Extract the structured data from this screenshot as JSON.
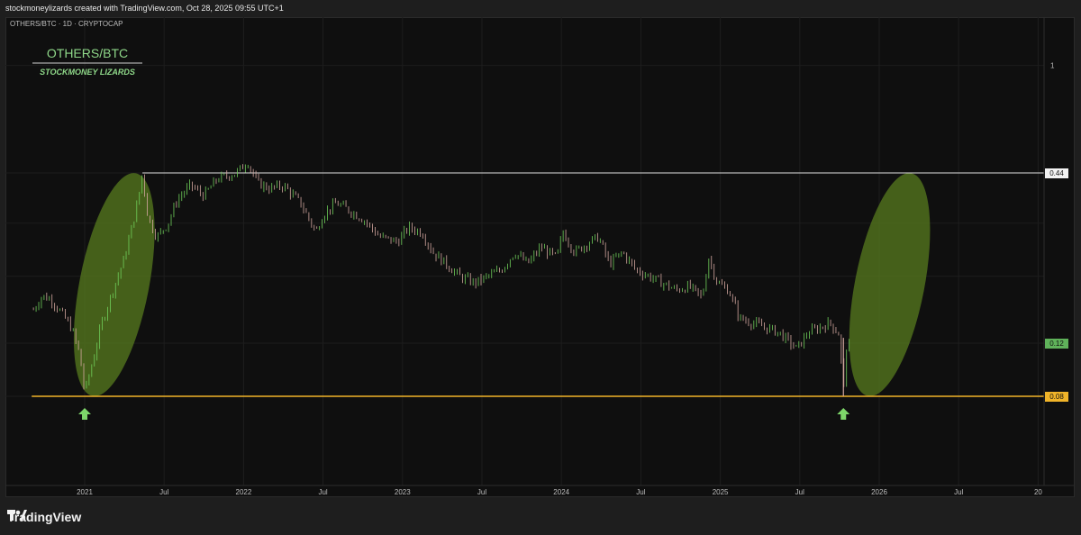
{
  "header": {
    "attribution": "stockmoneylizards created with TradingView.com, Oct 28, 2025 09:55 UTC+1"
  },
  "symbol_line": "OTHERS/BTC · 1D · CRYPTOCAP",
  "watermark": {
    "title": "OTHERS/BTC",
    "subtitle": "STOCKMONEY LIZARDS"
  },
  "footer": {
    "brand": "TradingView",
    "icon": "tradingview-logo-icon"
  },
  "colors": {
    "background": "#0f0f0f",
    "up": "#6fcf5a",
    "down": "#d4a7a0",
    "support": "#f0b429",
    "resistance": "#e0e0e0",
    "ellipse": "#55771e",
    "arrow": "#7ed66a"
  },
  "chart_data": {
    "type": "candlestick",
    "title": "OTHERS/BTC",
    "x_axis": {
      "type": "date",
      "range": [
        "2020-09-01",
        "2026-12-31"
      ],
      "tick_labels": [
        "2021",
        "Jul",
        "2022",
        "Jul",
        "2023",
        "Jul",
        "2024",
        "Jul",
        "2025",
        "Jul",
        "2026",
        "Jul",
        "20"
      ]
    },
    "y_axis": {
      "scale": "log",
      "range": [
        0.05,
        1.5
      ],
      "tick_labels": [
        "1"
      ],
      "right_side": true
    },
    "series": [
      {
        "type": "line-approximation",
        "points": [
          [
            "2020-09-05",
            0.155
          ],
          [
            "2020-09-25",
            0.172
          ],
          [
            "2020-10-15",
            0.168
          ],
          [
            "2020-11-10",
            0.15
          ],
          [
            "2020-12-01",
            0.135
          ],
          [
            "2020-12-20",
            0.11
          ],
          [
            "2021-01-01",
            0.082
          ],
          [
            "2021-01-20",
            0.105
          ],
          [
            "2021-02-10",
            0.14
          ],
          [
            "2021-03-05",
            0.18
          ],
          [
            "2021-04-01",
            0.23
          ],
          [
            "2021-05-01",
            0.35
          ],
          [
            "2021-05-12",
            0.44
          ],
          [
            "2021-05-25",
            0.31
          ],
          [
            "2021-06-15",
            0.27
          ],
          [
            "2021-07-10",
            0.3
          ],
          [
            "2021-08-01",
            0.36
          ],
          [
            "2021-09-01",
            0.4
          ],
          [
            "2021-10-01",
            0.37
          ],
          [
            "2021-11-01",
            0.42
          ],
          [
            "2021-12-15",
            0.44
          ],
          [
            "2022-01-10",
            0.48
          ],
          [
            "2022-02-01",
            0.41
          ],
          [
            "2022-03-01",
            0.39
          ],
          [
            "2022-04-01",
            0.4
          ],
          [
            "2022-05-10",
            0.35
          ],
          [
            "2022-06-15",
            0.28
          ],
          [
            "2022-07-01",
            0.32
          ],
          [
            "2022-08-01",
            0.35
          ],
          [
            "2022-09-01",
            0.33
          ],
          [
            "2022-10-01",
            0.31
          ],
          [
            "2022-11-10",
            0.27
          ],
          [
            "2022-12-20",
            0.26
          ],
          [
            "2023-01-15",
            0.29
          ],
          [
            "2023-02-15",
            0.28
          ],
          [
            "2023-03-10",
            0.24
          ],
          [
            "2023-04-10",
            0.22
          ],
          [
            "2023-05-10",
            0.2
          ],
          [
            "2023-06-15",
            0.19
          ],
          [
            "2023-07-15",
            0.2
          ],
          [
            "2023-08-15",
            0.21
          ],
          [
            "2023-09-15",
            0.24
          ],
          [
            "2023-10-15",
            0.22
          ],
          [
            "2023-11-15",
            0.25
          ],
          [
            "2023-12-20",
            0.23
          ],
          [
            "2024-01-05",
            0.28
          ],
          [
            "2024-02-01",
            0.24
          ],
          [
            "2024-03-05",
            0.26
          ],
          [
            "2024-03-25",
            0.27
          ],
          [
            "2024-04-20",
            0.22
          ],
          [
            "2024-05-20",
            0.24
          ],
          [
            "2024-06-20",
            0.21
          ],
          [
            "2024-07-20",
            0.2
          ],
          [
            "2024-08-20",
            0.19
          ],
          [
            "2024-09-20",
            0.18
          ],
          [
            "2024-10-20",
            0.185
          ],
          [
            "2024-11-20",
            0.17
          ],
          [
            "2024-12-05",
            0.23
          ],
          [
            "2024-12-25",
            0.19
          ],
          [
            "2025-01-20",
            0.18
          ],
          [
            "2025-02-15",
            0.145
          ],
          [
            "2025-03-15",
            0.14
          ],
          [
            "2025-04-15",
            0.135
          ],
          [
            "2025-05-15",
            0.13
          ],
          [
            "2025-06-10",
            0.12
          ],
          [
            "2025-06-25",
            0.115
          ],
          [
            "2025-07-20",
            0.13
          ],
          [
            "2025-08-15",
            0.135
          ],
          [
            "2025-09-10",
            0.14
          ],
          [
            "2025-10-01",
            0.128
          ],
          [
            "2025-10-10",
            0.08
          ],
          [
            "2025-10-15",
            0.115
          ],
          [
            "2025-10-27",
            0.12
          ]
        ]
      }
    ],
    "horizontal_levels": [
      {
        "name": "resistance",
        "value": 0.44,
        "label": "0.44",
        "from": "2021-05-12"
      },
      {
        "name": "support",
        "value": 0.08,
        "label": "0.08",
        "from": "2020-09-01"
      }
    ],
    "last_price": {
      "value": 0.12,
      "label": "0.12"
    },
    "annotations": [
      {
        "type": "ellipse",
        "name": "rally-2021",
        "center": [
          "2021-03-08",
          0.19
        ],
        "semi_months": 3.2,
        "y_span": [
          0.08,
          0.44
        ],
        "angle": "tilted right"
      },
      {
        "type": "ellipse",
        "name": "projected-rally",
        "center": [
          "2026-01-25",
          0.19
        ],
        "semi_months": 3.2,
        "y_span": [
          0.08,
          0.44
        ],
        "angle": "tilted right"
      },
      {
        "type": "arrow-up",
        "name": "bottom-2021",
        "date": "2021-01-01"
      },
      {
        "type": "arrow-up",
        "name": "bottom-2025",
        "date": "2025-10-10"
      }
    ],
    "grid": true
  }
}
